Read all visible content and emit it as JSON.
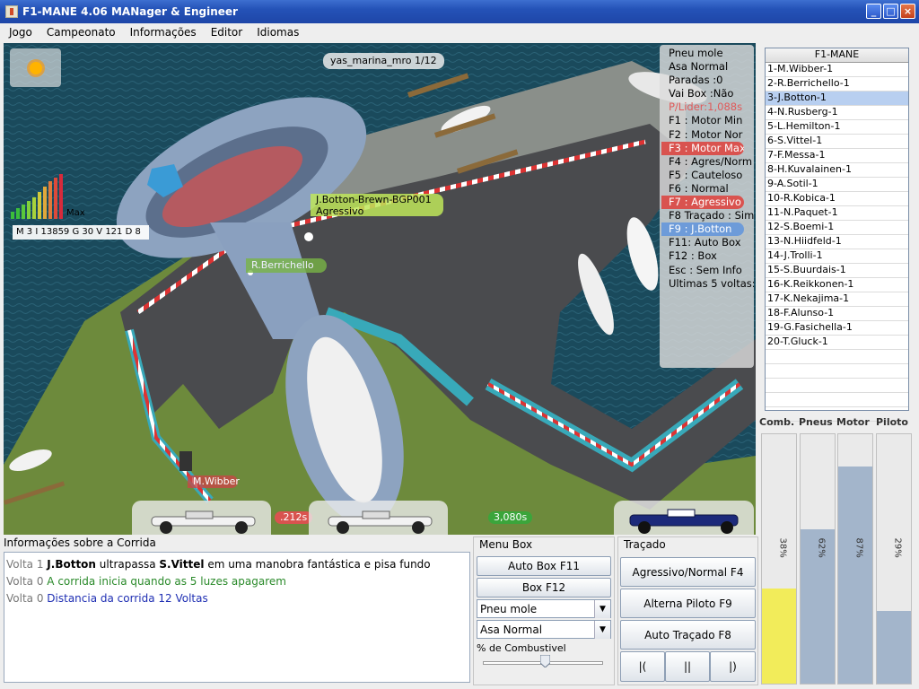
{
  "window": {
    "title": "F1-MANE 4.06 MANager & Engineer",
    "buttons": [
      "_",
      "□",
      "×"
    ]
  },
  "menu": [
    "Jogo",
    "Campeonato",
    "Informações",
    "Editor",
    "Idiomas"
  ],
  "track_view": {
    "track_name": "yas_marina_mro 1/12",
    "weather_icon": "sun-icon",
    "telemetry": "M 3 I 13859 G 30 V 121 D 8",
    "rpm_max_label": "Max",
    "driver_tags": {
      "botton_line1": "J.Botton-Brewn-BGP001",
      "botton_line2": "Agressivo",
      "berrichello": "R.Berrichello",
      "wibber": "M.Wibber"
    },
    "lap_times": [
      ".212s",
      "3,080s"
    ]
  },
  "info_panel": [
    {
      "text": "Pneu mole",
      "style": ""
    },
    {
      "text": "Asa Normal",
      "style": ""
    },
    {
      "text": "Paradas :0",
      "style": ""
    },
    {
      "text": "Vai Box :Não",
      "style": ""
    },
    {
      "text": "P/Lider:1,088s",
      "style": "red"
    },
    {
      "text": "F1 : Motor Min",
      "style": ""
    },
    {
      "text": "F2 : Motor Nor",
      "style": ""
    },
    {
      "text": "F3 : Motor Max",
      "style": "hl-red"
    },
    {
      "text": "F4 : Agres/Norm",
      "style": ""
    },
    {
      "text": "F5 : Cauteloso",
      "style": ""
    },
    {
      "text": "F6 : Normal",
      "style": ""
    },
    {
      "text": "F7 : Agressivo",
      "style": "hl-red"
    },
    {
      "text": "F8 Traçado : Sim",
      "style": ""
    },
    {
      "text": "F9 : J.Botton",
      "style": "hl-blue"
    },
    {
      "text": "F11: Auto Box",
      "style": ""
    },
    {
      "text": "F12 : Box",
      "style": ""
    },
    {
      "text": "Esc : Sem Info",
      "style": ""
    },
    {
      "text": "Ultimas 5 voltas:",
      "style": ""
    }
  ],
  "standings": {
    "header": "F1-MANE",
    "rows": [
      "1-M.Wibber-1",
      "2-R.Berrichello-1",
      "3-J.Botton-1",
      "4-N.Rusberg-1",
      "5-L.Hemilton-1",
      "6-S.Vittel-1",
      "7-F.Messa-1",
      "8-H.Kuvalainen-1",
      "9-A.Sotil-1",
      "10-R.Kobica-1",
      "11-N.Paquet-1",
      "12-S.Boemi-1",
      "13-N.Hiidfeld-1",
      "14-J.Trolli-1",
      "15-S.Buurdais-1",
      "16-K.Reikkonen-1",
      "17-K.Nekajima-1",
      "18-F.Alunso-1",
      "19-G.Fasichella-1",
      "20-T.Gluck-1",
      "",
      "",
      "",
      "",
      ""
    ],
    "selected_index": 2
  },
  "gauges": [
    {
      "label": "Comb.",
      "value": "38%",
      "fraction": 0.38,
      "color": "#f2ec5a"
    },
    {
      "label": "Pneus",
      "value": "62%",
      "fraction": 0.62,
      "color": "#a3b5cb"
    },
    {
      "label": "Motor",
      "value": "87%",
      "fraction": 0.87,
      "color": "#a3b5cb"
    },
    {
      "label": "Piloto",
      "value": "29%",
      "fraction": 0.29,
      "color": "#a3b5cb"
    }
  ],
  "race_info": {
    "title": "Informações sobre a Corrida",
    "log": [
      {
        "lap": "Volta 1",
        "driver_a": "J.Botton",
        "mid": " ultrapassa ",
        "driver_b": "S.Vittel",
        "rest": " em uma manobra fantástica e pisa fundo",
        "color": "#000000"
      },
      {
        "lap": "Volta 0",
        "driver_a": "",
        "mid": "",
        "driver_b": "",
        "rest": "A corrida inicia quando as 5 luzes apagarem",
        "color": "#2a8a2a"
      },
      {
        "lap": "Volta 0",
        "driver_a": "",
        "mid": "",
        "driver_b": "",
        "rest": "Distancia da corrida 12 Voltas",
        "color": "#1f2fb3"
      }
    ]
  },
  "menu_box": {
    "title": "Menu Box",
    "auto_box": "Auto Box F11",
    "box": "Box F12",
    "tyre_select": "Pneu mole",
    "wing_select": "Asa Normal",
    "fuel_label": "% de Combustivel",
    "fuel_fraction": 0.52
  },
  "tracado": {
    "title": "Traçado",
    "btn1": "Agressivo/Normal F4",
    "btn2": "Alterna Piloto F9",
    "btn3": "Auto Traçado F8",
    "small": [
      "|(",
      "||",
      "|)"
    ]
  },
  "colors": {
    "title_bar": "#2452b7",
    "water": "#174456",
    "selected_row": "#b8cff0",
    "fuel_gauge": "#f2ec5a"
  }
}
